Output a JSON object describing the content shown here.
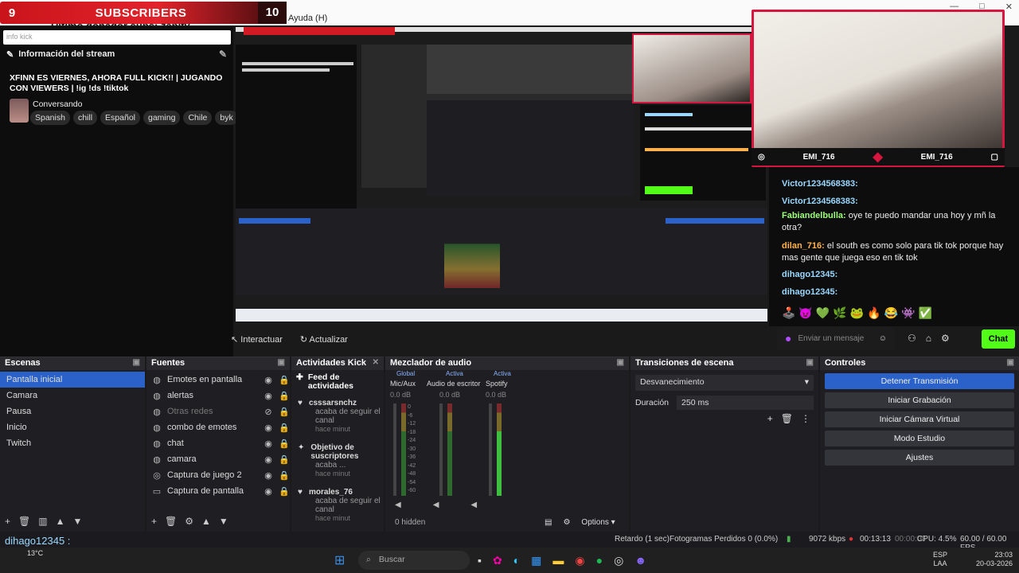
{
  "overlay": {
    "sub_left": "9",
    "sub_title": "SUBSCRIBERS",
    "sub_right": "10",
    "donor_text": "Ultimo donador subs: zapity",
    "menu_help": "Ayuda (H)"
  },
  "info_panel": {
    "search_placeholder": "info kick",
    "header": "Información del stream",
    "stream_title": "XFINN ES VIERNES, AHORA FULL KICK!! | JUGANDO CON VIEWERS | !ig !ds !tiktok",
    "category": "Conversando",
    "tags": [
      "Spanish",
      "chill",
      "Español",
      "gaming",
      "Chile",
      "byk"
    ]
  },
  "webcam": {
    "left_name": "EMI_716",
    "right_name": "EMI_716"
  },
  "chat": {
    "lines": [
      {
        "user": "Victor1234568383:",
        "msg": ""
      },
      {
        "user": "Victor1234568383:",
        "msg": ""
      },
      {
        "user": "Fabiandelbulla:",
        "msg": "oye te puedo mandar una hoy y mñ la otra?"
      },
      {
        "user": "dilan_716:",
        "msg": "el south es como solo para tik tok porque hay mas gente que juega eso en tik tok"
      },
      {
        "user": "dihago12345:",
        "msg": ""
      },
      {
        "user": "dihago12345:",
        "msg": ""
      }
    ],
    "input_placeholder": "Enviar un mensaje",
    "send_button": "Chat"
  },
  "toolbar": {
    "interact": "Interactuar",
    "refresh": "Actualizar"
  },
  "scenes": {
    "title": "Escenas",
    "items": [
      "Pantalla inicial",
      "Camara",
      "Pausa",
      "Inicio",
      "Twitch"
    ]
  },
  "sources": {
    "title": "Fuentes",
    "items": [
      "Emotes en pantalla",
      "alertas",
      "Otras redes",
      "combo de emotes",
      "chat",
      "camara",
      "Captura de juego 2",
      "Captura de pantalla"
    ]
  },
  "kick_activity": {
    "title": "Actividades Kick",
    "feed_title": "Feed de actividades",
    "events": [
      {
        "name": "csssarsnchz",
        "sub": "acaba de seguir el canal",
        "time": "hace minut"
      },
      {
        "name": "Objetivo de suscriptores",
        "sub": "acaba ...",
        "time": "hace minut"
      },
      {
        "name": "morales_76",
        "sub": "acaba de seguir el canal",
        "time": "hace minut"
      }
    ]
  },
  "mixer": {
    "title": "Mezclador de audio",
    "global_label": "Global",
    "active_label": "Activa",
    "channels": [
      {
        "name": "Mic/Aux",
        "db": "0.0 dB"
      },
      {
        "name": "Audio de escritor",
        "db": "0.0 dB"
      },
      {
        "name": "Spotify",
        "db": "0.0 dB"
      }
    ],
    "scale": [
      "0",
      "-6",
      "-12",
      "-18",
      "-24",
      "-30",
      "-36",
      "-42",
      "-48",
      "-54",
      "-60"
    ],
    "hidden": "0 hidden",
    "options": "Options"
  },
  "transitions": {
    "title": "Transiciones de escena",
    "selected": "Desvanecimiento",
    "duration_label": "Duración",
    "duration_value": "250 ms"
  },
  "controls": {
    "title": "Controles",
    "buttons": [
      "Detener Transmisión",
      "Iniciar Grabación",
      "Iniciar Cámara Virtual",
      "Modo Estudio",
      "Ajustes"
    ]
  },
  "status": {
    "delay": "Retardo (1 sec)",
    "frames": "Fotogramas Perdidos 0 (0.0%)",
    "bitrate": "9072 kbps",
    "live_time": "00:13:13",
    "rec_time": "00:00:00",
    "cpu": "CPU: 4.5%",
    "fps": "60.00 / 60.00 FPS"
  },
  "taskbar": {
    "chat_overlay": "dihago12345 :",
    "weather": "13°C",
    "search": "Buscar",
    "lang_1": "ESP",
    "lang_2": "LAA",
    "time": "23:03",
    "date": "20-03-2026"
  },
  "colors": {
    "accent_blue": "#2a62c9",
    "kick_green": "#53fc18",
    "brand_red": "#d6163e"
  }
}
